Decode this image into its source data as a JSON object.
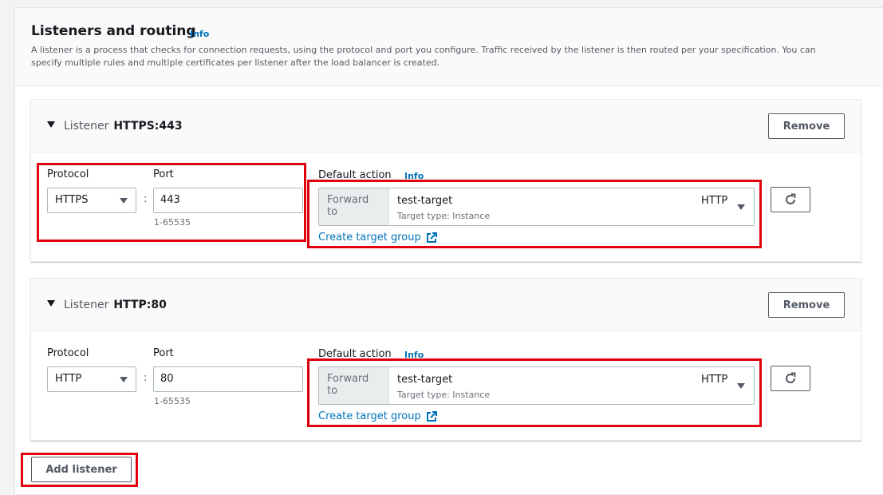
{
  "section": {
    "title": "Listeners and routing",
    "info": "Info",
    "description": "A listener is a process that checks for connection requests, using the protocol and port you configure. Traffic received by the listener is then routed per your specification. You can specify multiple rules and multiple certificates per listener after the load balancer is created."
  },
  "listeners": [
    {
      "prefix": "Listener",
      "name": "HTTPS:443",
      "remove_label": "Remove",
      "protocol_label": "Protocol",
      "protocol_value": "HTTPS",
      "port_label": "Port",
      "port_value": "443",
      "port_hint": "1-65535",
      "default_action_label": "Default action",
      "default_action_info": "Info",
      "forward_label": "Forward to",
      "target_name": "test-target",
      "target_type": "Target type: Instance",
      "target_protocol": "HTTP",
      "create_link": "Create target group"
    },
    {
      "prefix": "Listener",
      "name": "HTTP:80",
      "remove_label": "Remove",
      "protocol_label": "Protocol",
      "protocol_value": "HTTP",
      "port_label": "Port",
      "port_value": "80",
      "port_hint": "1-65535",
      "default_action_label": "Default action",
      "default_action_info": "Info",
      "forward_label": "Forward to",
      "target_name": "test-target",
      "target_type": "Target type: Instance",
      "target_protocol": "HTTP",
      "create_link": "Create target group"
    }
  ],
  "add_listener_label": "Add listener",
  "colors": {
    "link": "#0073bb",
    "highlight": "#e0000d",
    "border": "#aab7b8",
    "header_bg": "#fafafa"
  },
  "icons": [
    "caret-down-icon",
    "dropdown-arrow-icon",
    "external-link-icon",
    "refresh-icon"
  ]
}
